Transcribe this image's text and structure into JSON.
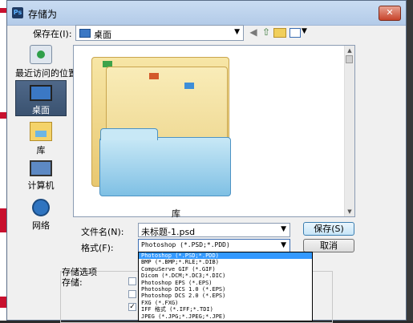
{
  "window": {
    "title": "存储为",
    "app_icon": "Ps",
    "close_glyph": "✕"
  },
  "toolbar": {
    "save_in_label": "保存在(I):",
    "location": "桌面"
  },
  "sidebar": {
    "items": [
      {
        "label": "最近访问的位置",
        "icon": "recent-places-icon"
      },
      {
        "label": "桌面",
        "icon": "desktop-icon",
        "selected": true
      },
      {
        "label": "库",
        "icon": "libraries-icon"
      },
      {
        "label": "计算机",
        "icon": "computer-icon"
      },
      {
        "label": "网络",
        "icon": "network-icon"
      }
    ]
  },
  "filelist": {
    "items": [
      {
        "label": "库",
        "icon": "library-folder-icon"
      }
    ]
  },
  "form": {
    "filename_label": "文件名(N):",
    "filename_value": "未标题-1.psd",
    "format_label": "格式(F):",
    "format_value": "Photoshop (*.PSD;*.PDD)",
    "save_label": "保存(S)",
    "cancel_label": "取消"
  },
  "options": {
    "section_label": "存储选项",
    "store_label": "存储:"
  },
  "format_dropdown": {
    "options": [
      "Photoshop (*.PSD;*.PDD)",
      "BMP (*.BMP;*.RLE;*.DIB)",
      "CompuServe GIF (*.GIF)",
      "Dicom (*.DCM;*.DC3;*.DIC)",
      "Photoshop EPS (*.EPS)",
      "Photoshop DCS 1.0 (*.EPS)",
      "Photoshop DCS 2.0 (*.EPS)",
      "FXG (*.FXG)",
      "IFF 格式 (*.IFF;*.TDI)",
      "JPEG (*.JPG;*.JPEG;*.JPE)"
    ],
    "selected_index": 0
  },
  "colors": {
    "selection": "#3399ff",
    "sidebar_selected": "#3a5270",
    "title_bar": "#b3cbe8"
  }
}
